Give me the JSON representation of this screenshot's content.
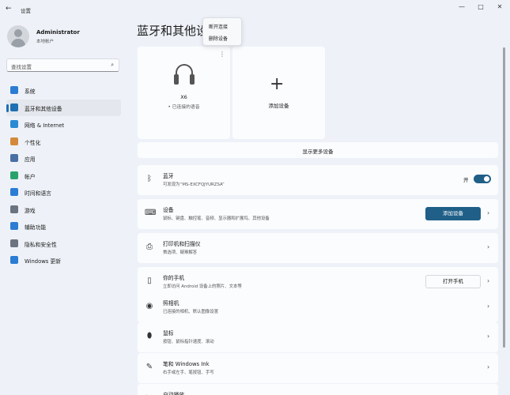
{
  "window": {
    "back_glyph": "←",
    "title": "设置",
    "min_glyph": "—",
    "max_glyph": "□",
    "close_glyph": "✕"
  },
  "profile": {
    "name": "Administrator",
    "account": "本地帐户"
  },
  "search": {
    "placeholder": "查找设置",
    "icon": "⌕"
  },
  "sidebar": {
    "active_index": 1,
    "items": [
      {
        "label": "系统",
        "icon": "system-icon",
        "color": "#2b7cd3"
      },
      {
        "label": "蓝牙和其他设备",
        "icon": "bluetooth-icon",
        "color": "#1f6fb2"
      },
      {
        "label": "网络 & Internet",
        "icon": "network-icon",
        "color": "#2a8ad4"
      },
      {
        "label": "个性化",
        "icon": "brush-icon",
        "color": "#d48a3a"
      },
      {
        "label": "应用",
        "icon": "apps-icon",
        "color": "#4a6fa5"
      },
      {
        "label": "帐户",
        "icon": "account-icon",
        "color": "#2aa36b"
      },
      {
        "label": "时间和语言",
        "icon": "clock-globe-icon",
        "color": "#2b7cd3"
      },
      {
        "label": "游戏",
        "icon": "gamepad-icon",
        "color": "#6b7480"
      },
      {
        "label": "辅助功能",
        "icon": "accessibility-icon",
        "color": "#2b7cd3"
      },
      {
        "label": "隐私和安全性",
        "icon": "shield-icon",
        "color": "#6b7480"
      },
      {
        "label": "Windows 更新",
        "icon": "update-icon",
        "color": "#2b7cd3"
      }
    ]
  },
  "main": {
    "title": "蓝牙和其他设",
    "device_card": {
      "more_glyph": "⋮",
      "name": "X6",
      "status": "• 已连接的语音"
    },
    "add_card": {
      "plus_glyph": "+",
      "label": "添加设备"
    },
    "context_menu": {
      "items": [
        "断开连接",
        "删除设备"
      ]
    },
    "show_more": "显示更多设备",
    "bluetooth": {
      "title": "蓝牙",
      "subtitle": "可发现为“MS-EXCFQJYURZSA”",
      "toggle_label": "开",
      "enabled": true
    },
    "rows": [
      {
        "title": "设备",
        "subtitle": "鼠标、键盘、触控笔、音频、显示器和扩展坞、其他设备",
        "icon": "keyboard-icon",
        "icon_glyph": "⌨",
        "button": "添加设备",
        "button_style": "accent"
      },
      {
        "title": "打印机和扫描仪",
        "subtitle": "首选项、疑难解答",
        "icon": "printer-icon",
        "icon_glyph": "⎙"
      },
      {
        "title": "你的手机",
        "subtitle": "立即访问 Android 设备上的照片、文本等",
        "icon": "phone-icon",
        "icon_glyph": "▯",
        "button": "打开手机",
        "button_style": "plain"
      },
      {
        "title": "照相机",
        "subtitle": "已连接的相机、默认图像设置",
        "icon": "camera-icon",
        "icon_glyph": "◉"
      },
      {
        "title": "鼠标",
        "subtitle": "按钮、鼠标指针速度、滚动",
        "icon": "mouse-icon",
        "icon_glyph": "⬮"
      },
      {
        "title": "笔和 Windows Ink",
        "subtitle": "右手或左手、笔按钮、手写",
        "icon": "pen-icon",
        "icon_glyph": "✎"
      },
      {
        "title": "自动播放",
        "subtitle": "",
        "icon": "autoplay-icon",
        "icon_glyph": "▷"
      }
    ],
    "chevron": "›"
  }
}
